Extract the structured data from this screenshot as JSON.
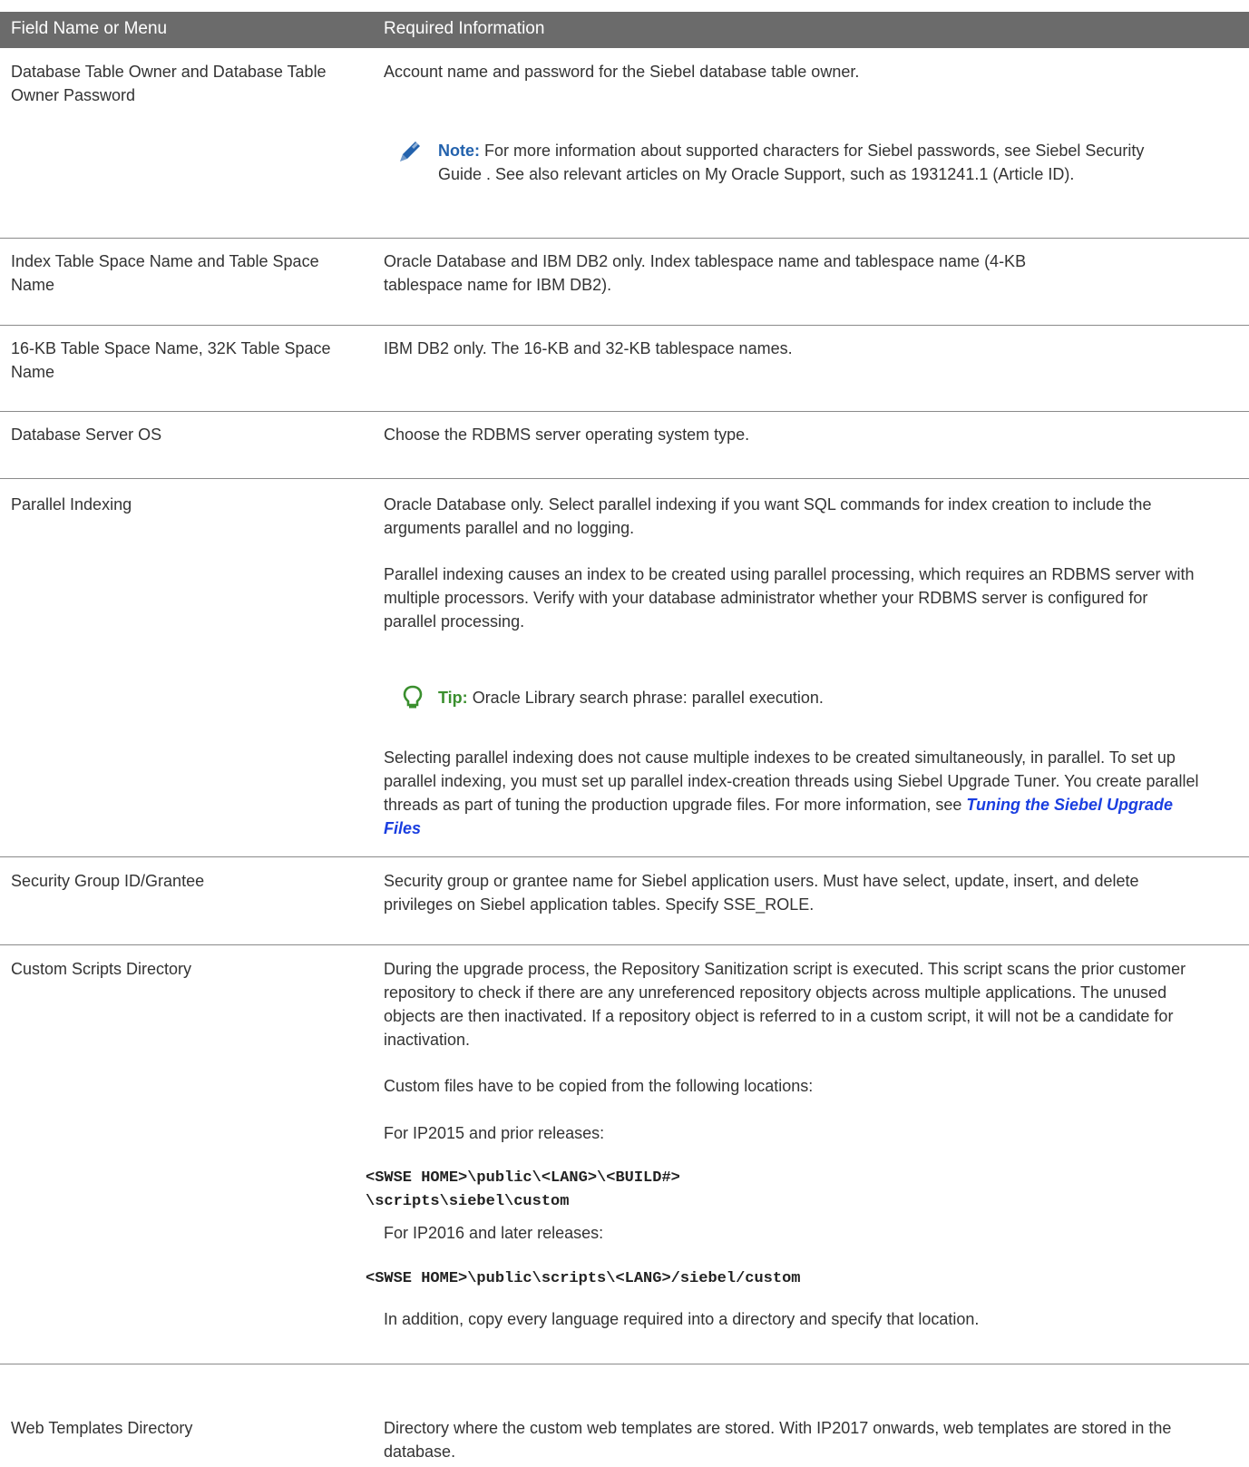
{
  "header": {
    "col1": "Field Name or Menu",
    "col2": "Required Information"
  },
  "rows": {
    "db_owner": {
      "field": "Database Table Owner and Database Table Owner Password",
      "info": "Account name and password for the Siebel database table owner.",
      "note_label": "Note:",
      "note_text": "For more information about supported characters for Siebel passwords, see  Siebel Security Guide . See also relevant articles on My Oracle Support, such as 1931241.1 (Article ID)."
    },
    "index_space": {
      "field": "Index Table Space Name and Table Space Name",
      "info": "Oracle Database and IBM DB2 only. Index tablespace name and tablespace name (4-KB tablespace name for IBM DB2)."
    },
    "kb_space": {
      "field": "16-KB Table Space Name, 32K Table Space Name",
      "info": "IBM DB2 only. The 16-KB and 32-KB tablespace names."
    },
    "server_os": {
      "field": "Database Server OS",
      "info": "Choose the RDBMS server operating system type."
    },
    "parallel": {
      "field": "Parallel Indexing",
      "p1": "Oracle Database only. Select parallel indexing if you want SQL commands for index creation to include the arguments parallel and no logging.",
      "p2": "Parallel indexing causes an index to be created using parallel processing, which requires an RDBMS server with multiple processors. Verify with your database administrator whether your RDBMS server is configured for parallel processing.",
      "tip_label": "Tip:",
      "tip_text": "Oracle Library search phrase: parallel execution.",
      "p3": "Selecting parallel indexing does not cause multiple indexes to be created simultaneously, in parallel. To set up parallel indexing, you must set up parallel index-creation threads using Siebel Upgrade Tuner. You create parallel threads as part of tuning the production upgrade files. For more information, see ",
      "p3_link": "Tuning the Siebel Upgrade Files"
    },
    "security": {
      "field": "Security Group ID/Grantee",
      "info": "Security group or grantee name for Siebel application users. Must have select, update, insert, and delete privileges on Siebel application tables. Specify SSE_ROLE."
    },
    "custom_scripts": {
      "field": "Custom Scripts Directory",
      "p1": "During the upgrade process, the Repository Sanitization script is executed. This script scans the prior customer repository to check if there are any unreferenced repository objects across multiple applications. The unused objects are then inactivated. If a repository object is referred to in a custom script, it will not be a candidate for inactivation.",
      "p2": "Custom files have to be copied from the following locations:",
      "p3": "For IP2015 and prior releases:",
      "code1_line1": "<SWSE HOME>\\public\\<LANG>\\<BUILD#>",
      "code1_line2": "\\scripts\\siebel\\custom",
      "p4": "For IP2016 and later releases:",
      "code2": "<SWSE HOME>\\public\\scripts\\<LANG>/siebel/custom",
      "p5": "In addition, copy every language required into a directory and specify that location."
    },
    "web_templates": {
      "field": "Web Templates Directory",
      "info": "Directory where the custom web templates are stored. With IP2017 onwards, web templates are stored in the database."
    }
  },
  "colors": {
    "header_bg": "#6b6b6b",
    "note_blue": "#2362ad",
    "tip_green": "#3a8f2e",
    "link_blue": "#1a3ee0"
  },
  "icons": [
    "pencil-icon",
    "lightbulb-icon"
  ]
}
